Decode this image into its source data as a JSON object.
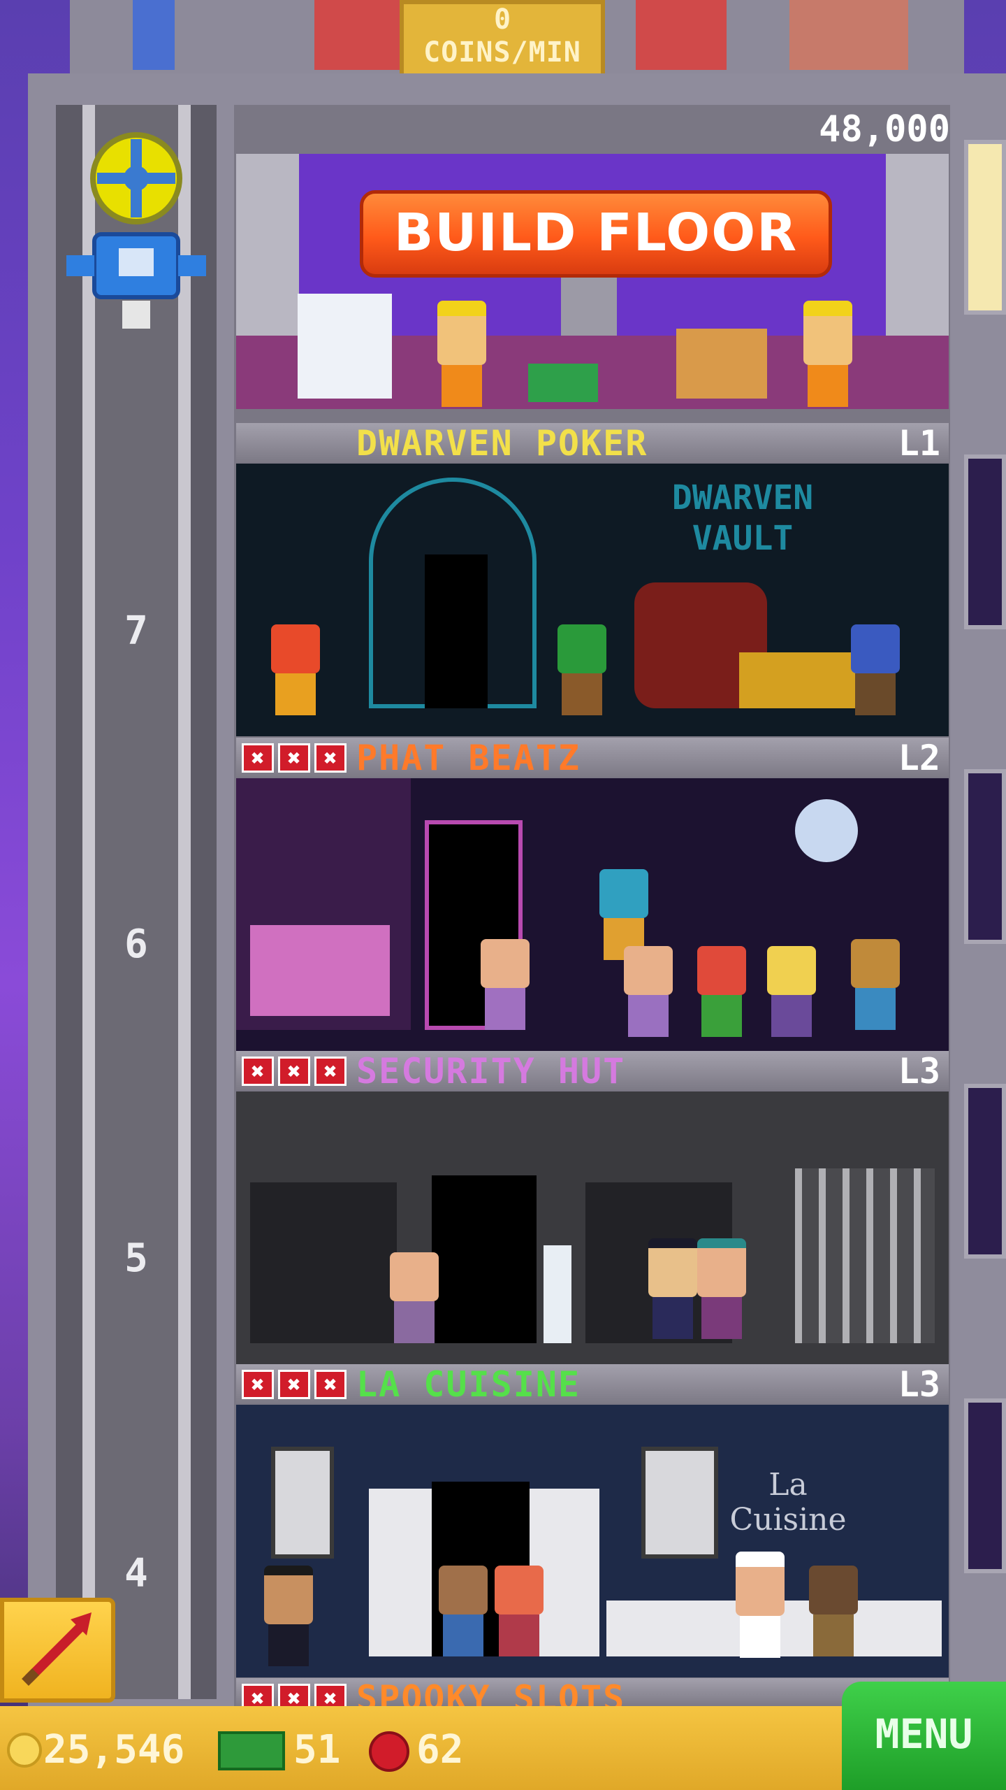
{
  "header": {
    "coins_per_min_value": "0",
    "coins_per_min_label": "COINS/MIN"
  },
  "build": {
    "cost": "48,000",
    "button_label": "BUILD FLOOR"
  },
  "elevator": {
    "floor_numbers": [
      "7",
      "6",
      "5",
      "4"
    ]
  },
  "floors": [
    {
      "name": "DWARVEN POKER",
      "level": "L1",
      "name_color": "#f2e04a",
      "stars_missing": 0,
      "sign": "DWARVEN VAULT"
    },
    {
      "name": "PHAT BEATZ",
      "level": "L2",
      "name_color": "#ff7a2a",
      "stars_missing": 3
    },
    {
      "name": "SECURITY HUT",
      "level": "L3",
      "name_color": "#d57adf",
      "stars_missing": 3
    },
    {
      "name": "LA CUISINE",
      "level": "L3",
      "name_color": "#55e04a",
      "stars_missing": 3,
      "sign": "La Cuisine"
    },
    {
      "name": "SPOOKY SLOTS",
      "name_color": "#ff8a2a",
      "stars_missing": 3
    }
  ],
  "resources": {
    "coins": "25,546",
    "bux": "51",
    "tickets": "62"
  },
  "menu": {
    "label": "MENU"
  },
  "colors": {
    "accent_orange": "#ff5a1a",
    "menu_green": "#2fbe3a",
    "gold": "#f0b320"
  },
  "icons": [
    "coin-icon",
    "bux-icon",
    "ticket-icon",
    "rocket-icon",
    "elevator-icon",
    "star-missing-icon"
  ]
}
